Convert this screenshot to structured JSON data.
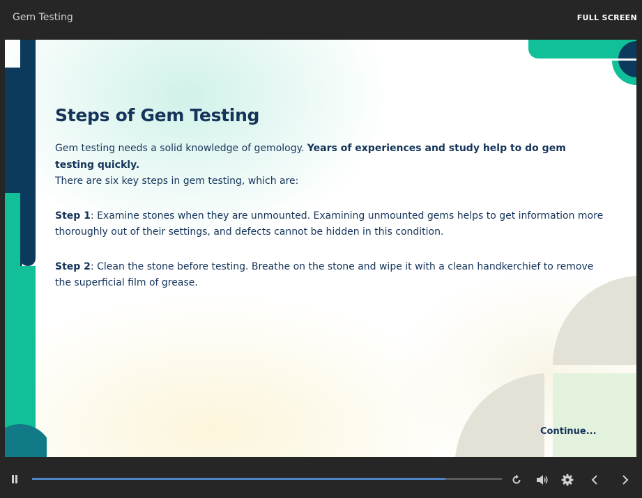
{
  "header": {
    "course_title": "Gem Testing",
    "fullscreen_label": "FULL SCREEN"
  },
  "slide": {
    "heading": "Steps of Gem Testing",
    "intro": {
      "text": "Gem testing needs a solid knowledge of gemology. ",
      "bold": "Years of experiences and study help to do gem testing quickly.",
      "text2": "There are six key steps in gem testing, which are:"
    },
    "steps": [
      {
        "label": "Step 1",
        "text": ": Examine stones when they are unmounted. Examining unmounted gems helps to get information more thoroughly out of their settings, and defects cannot be hidden in this condition."
      },
      {
        "label": "Step 2",
        "text": ": Clean the stone before testing. Breathe on the stone and wipe it with a clean handkerchief to remove the superficial film of grease."
      }
    ],
    "continue_label": "Continue..."
  },
  "player": {
    "progress": 0.88,
    "icons": {
      "pause": "pause-icon",
      "replay": "replay-icon",
      "volume": "volume-icon",
      "settings": "gear-icon",
      "previous": "chevron-left-icon",
      "next": "chevron-right-icon"
    }
  },
  "colors": {
    "heading": "#15345a",
    "teal": "#11bf98",
    "navy": "#0c3a5c",
    "dark_teal": "#117a86",
    "progress": "#4d84c7",
    "chrome": "#262626"
  }
}
